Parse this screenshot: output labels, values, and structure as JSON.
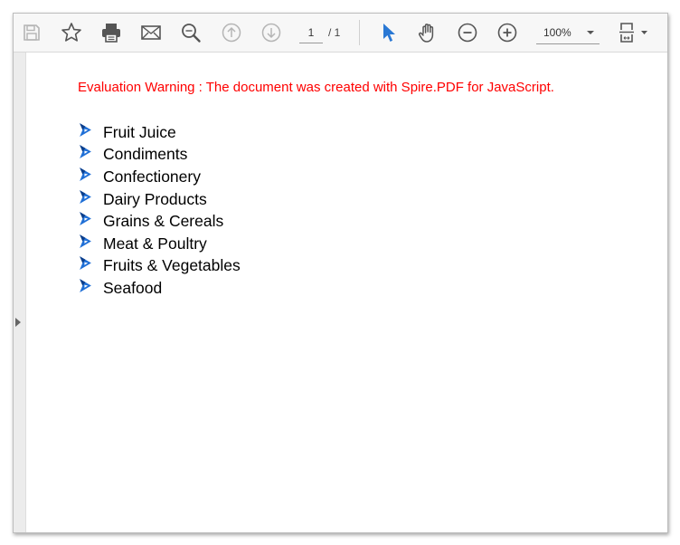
{
  "toolbar": {
    "page_current": "1",
    "page_total": "/ 1",
    "zoom": "100%"
  },
  "icons": {
    "save": "save-icon",
    "bookmark": "star-icon",
    "print": "printer-icon",
    "email": "mail-icon",
    "search": "search-icon",
    "prev_page": "arrow-up-circle-icon",
    "next_page": "arrow-down-circle-icon",
    "select": "cursor-icon",
    "pan": "hand-icon",
    "zoom_out": "minus-circle-icon",
    "zoom_in": "plus-circle-icon",
    "fit": "fit-page-icon"
  },
  "colors": {
    "warning": "#ff0000",
    "accent": "#2a78d4"
  },
  "document": {
    "warning": "Evaluation Warning : The document was created with Spire.PDF for JavaScript.",
    "items": [
      "Fruit Juice",
      "Condiments",
      "Confectionery",
      "Dairy Products",
      "Grains & Cereals",
      "Meat & Poultry",
      "Fruits & Vegetables",
      "Seafood"
    ]
  }
}
